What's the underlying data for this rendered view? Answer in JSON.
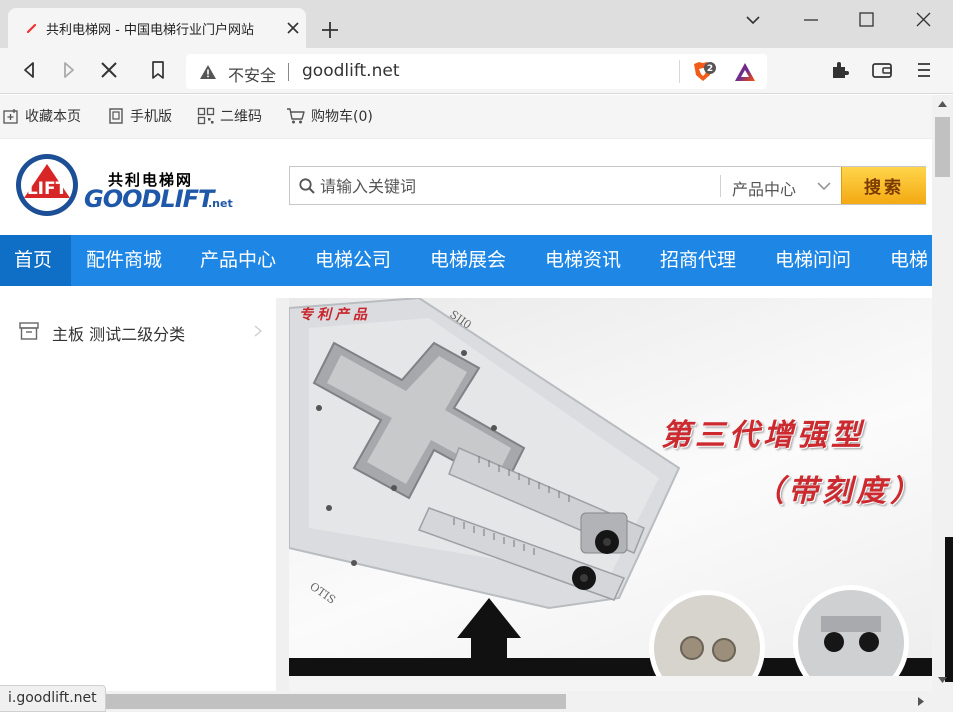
{
  "browser": {
    "tab_title": "共利电梯网 - 中国电梯行业门户网站",
    "security_label": "不安全",
    "url": "goodlift.net",
    "brave_badge_count": "2",
    "status_url": "i.goodlift.net"
  },
  "topbar": {
    "favorite": "收藏本页",
    "mobile": "手机版",
    "qrcode": "二维码",
    "cart": "购物车(0)"
  },
  "logo": {
    "text_cn": "共利电梯网",
    "text_en": "GOODLIFT",
    "text_domain": ".net",
    "mark": "LIFT"
  },
  "search": {
    "placeholder": "请输入关键词",
    "category": "产品中心",
    "button": "搜索"
  },
  "nav": {
    "items": [
      "首页",
      "配件商城",
      "产品中心",
      "电梯公司",
      "电梯展会",
      "电梯资讯",
      "招商代理",
      "电梯问问",
      "电梯"
    ],
    "active_index": 0
  },
  "category": {
    "item_label": "主板 测试二级分类"
  },
  "banner": {
    "tag": "专利产品",
    "headline": "第三代增强型",
    "subheadline": "（带刻度）",
    "plate_mark_1": "SII0",
    "plate_mark_2": "OTIS"
  },
  "colors": {
    "nav_blue": "#1e87e5",
    "nav_active": "#0f6fc6",
    "search_button": "#f5b41c",
    "banner_red": "#cc2a2f"
  }
}
